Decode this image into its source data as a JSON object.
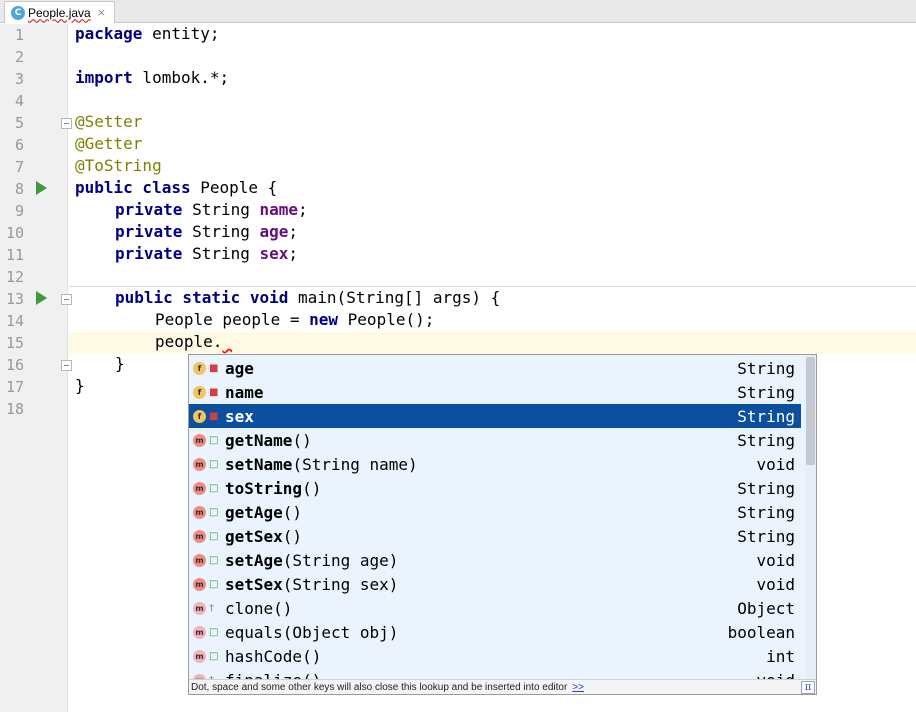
{
  "tab": {
    "label": "People.java",
    "close": "×",
    "icon": "C"
  },
  "line_numbers": [
    "1",
    "2",
    "3",
    "4",
    "5",
    "6",
    "7",
    "8",
    "9",
    "10",
    "11",
    "12",
    "13",
    "14",
    "15",
    "16",
    "17",
    "18"
  ],
  "code": {
    "l1_kw": "package",
    "l1_rest": " entity;",
    "l3_kw": "import",
    "l3_rest": " lombok.*;",
    "l5": "@Setter",
    "l6": "@Getter",
    "l7": "@ToString",
    "l8_kw": "public class",
    "l8_rest": " People {",
    "l9_kw": "private",
    "l9_type": " String ",
    "l9_field": "name",
    "l9_end": ";",
    "l10_kw": "private",
    "l10_type": " String ",
    "l10_field": "age",
    "l10_end": ";",
    "l11_kw": "private",
    "l11_type": " String ",
    "l11_field": "sex",
    "l11_end": ";",
    "l13_kw": "public static void",
    "l13_rest": " main(String[] args) {",
    "l14_a": "People people = ",
    "l14_kw": "new",
    "l14_b": " People();",
    "l15": "people.",
    "l16": "}",
    "l17": "}"
  },
  "completion": {
    "items": [
      {
        "kind": "f",
        "name": "age",
        "params": "",
        "type": "String"
      },
      {
        "kind": "f",
        "name": "name",
        "params": "",
        "type": "String"
      },
      {
        "kind": "f",
        "name": "sex",
        "params": "",
        "type": "String"
      },
      {
        "kind": "m",
        "name": "getName",
        "params": "()",
        "type": "String"
      },
      {
        "kind": "m",
        "name": "setName",
        "params": "(String name)",
        "type": "void"
      },
      {
        "kind": "m",
        "name": "toString",
        "params": "()",
        "type": "String"
      },
      {
        "kind": "m",
        "name": "getAge",
        "params": "()",
        "type": "String"
      },
      {
        "kind": "m",
        "name": "getSex",
        "params": "()",
        "type": "String"
      },
      {
        "kind": "m",
        "name": "setAge",
        "params": "(String age)",
        "type": "void"
      },
      {
        "kind": "m",
        "name": "setSex",
        "params": "(String sex)",
        "type": "void"
      },
      {
        "kind": "m",
        "name": "clone",
        "params": "()",
        "type": "Object"
      },
      {
        "kind": "m",
        "name": "equals",
        "params": "(Object obj)",
        "type": "boolean"
      },
      {
        "kind": "m",
        "name": "hashCode",
        "params": "()",
        "type": "int"
      },
      {
        "kind": "m",
        "name": "finalize",
        "params": "()",
        "type": "void"
      }
    ],
    "selected_index": 2,
    "hint": "Dot, space and some other keys will also close this lookup and be inserted into editor",
    "hint_link": ">>",
    "pi": "π"
  }
}
